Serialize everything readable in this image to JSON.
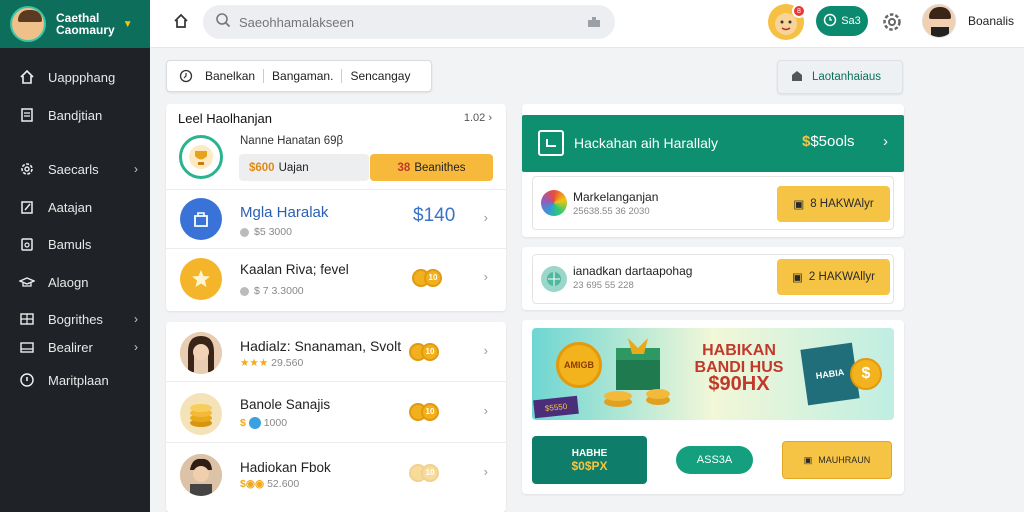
{
  "sidebar": {
    "brand_line1": "Caethal",
    "brand_line2": "Caomaury",
    "items": [
      {
        "label": "Uappphang",
        "icon": "home-icon"
      },
      {
        "label": "Bandjtian",
        "icon": "document-icon"
      },
      {
        "label": "Saecarls",
        "icon": "gear-icon"
      },
      {
        "label": "Aatajan",
        "icon": "edit-icon"
      },
      {
        "label": "Bamuls",
        "icon": "wallet-icon"
      },
      {
        "label": "Alaogn",
        "icon": "hat-icon"
      },
      {
        "label": "Bogrithes",
        "icon": "grid-icon"
      },
      {
        "label": "Bealirer",
        "icon": "card-icon"
      },
      {
        "label": "Maritplaan",
        "icon": "info-icon"
      }
    ]
  },
  "topbar": {
    "search_placeholder": "Saeohhamalakseen",
    "pill_label": "Sa3",
    "notif_count": "8",
    "username": "Boanalis"
  },
  "tabs": [
    "Banelkan",
    "Bangaman.",
    "Sencangay"
  ],
  "panel_button": "Laotanhaiaus",
  "list1": {
    "title": "Leel Haolhanjan",
    "page": "1.02",
    "first": {
      "title": "Nanne Hanatan 69β",
      "tag1_value": "$600",
      "tag1_label": "Uajan",
      "tag2_value": "38",
      "tag2_label": "Beanithes"
    },
    "rows": [
      {
        "title": "Mgla Haralak",
        "sub": "$5 3000",
        "amount": "$140"
      },
      {
        "title": "Kaalan Riva; fevel",
        "sub": "$ 7 3.3000",
        "coin": "10"
      }
    ]
  },
  "list2": {
    "rows": [
      {
        "title": "Hadialz: Snanaman, Svolt",
        "sub": "29.560",
        "coin": "10"
      },
      {
        "title": "Banole Sanajis",
        "sub": "1000",
        "coin": "10"
      },
      {
        "title": "Hadiokan Fbok",
        "sub": "52.600",
        "coin": "10"
      }
    ]
  },
  "hero": {
    "title": "Hackahan aih Harallaly",
    "amount": "$5ools"
  },
  "offers": [
    {
      "title": "Markelanganjan",
      "sub": "25638.55 36 2030",
      "button": "8 HAKWAlyr"
    },
    {
      "title": "ianadkan dartaapohag",
      "sub": "23 695 55 228",
      "button": "2 HAKWAllyr"
    }
  ],
  "promo": {
    "badge": "AMIGB",
    "headline1": "HABIKAN",
    "headline2": "BANDI HUS",
    "headline3": "$90HX",
    "ticket": "$5550",
    "chest": "HABIA",
    "cta1_line1": "HABHE",
    "cta1_line2": "$0$PX",
    "cta2": "ASS3A",
    "cta3": "MAUHRAUN"
  },
  "colors": {
    "brand": "#0e6e5c",
    "accent": "#0b8a6f",
    "highlight": "#f6c444",
    "sidebar": "#1f2327"
  }
}
